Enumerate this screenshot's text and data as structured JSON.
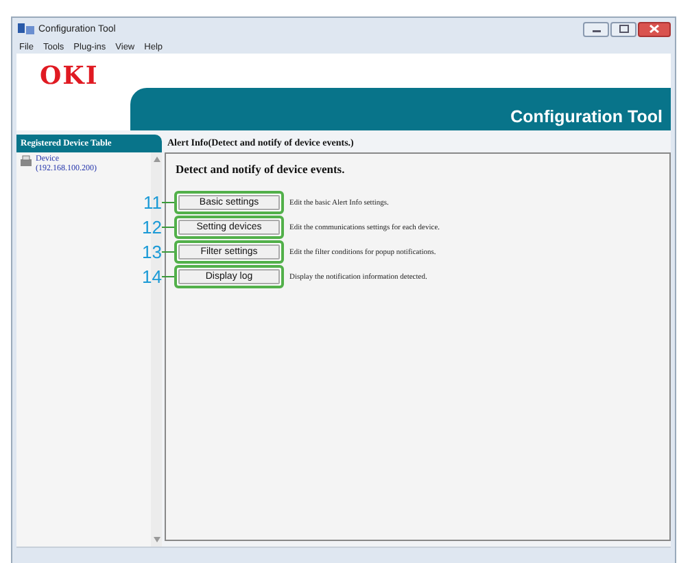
{
  "window": {
    "title": "Configuration Tool"
  },
  "menu": [
    "File",
    "Tools",
    "Plug-ins",
    "View",
    "Help"
  ],
  "header": {
    "logo": "OKI",
    "title": "Configuration Tool"
  },
  "sidebar": {
    "title": "Registered Device Table",
    "devices": [
      {
        "name": "Device",
        "address": "(192.168.100.200)"
      }
    ]
  },
  "panel": {
    "title": "Alert Info(Detect and notify of device events.)",
    "heading": "Detect and notify of device events.",
    "actions": [
      {
        "callout": "11",
        "label": "Basic settings",
        "description": "Edit the basic Alert Info settings."
      },
      {
        "callout": "12",
        "label": "Setting devices",
        "description": "Edit the communications settings for each device."
      },
      {
        "callout": "13",
        "label": "Filter settings",
        "description": "Edit the filter conditions for popup notifications."
      },
      {
        "callout": "14",
        "label": "Display log",
        "description": "Display the notification information detected."
      }
    ]
  }
}
